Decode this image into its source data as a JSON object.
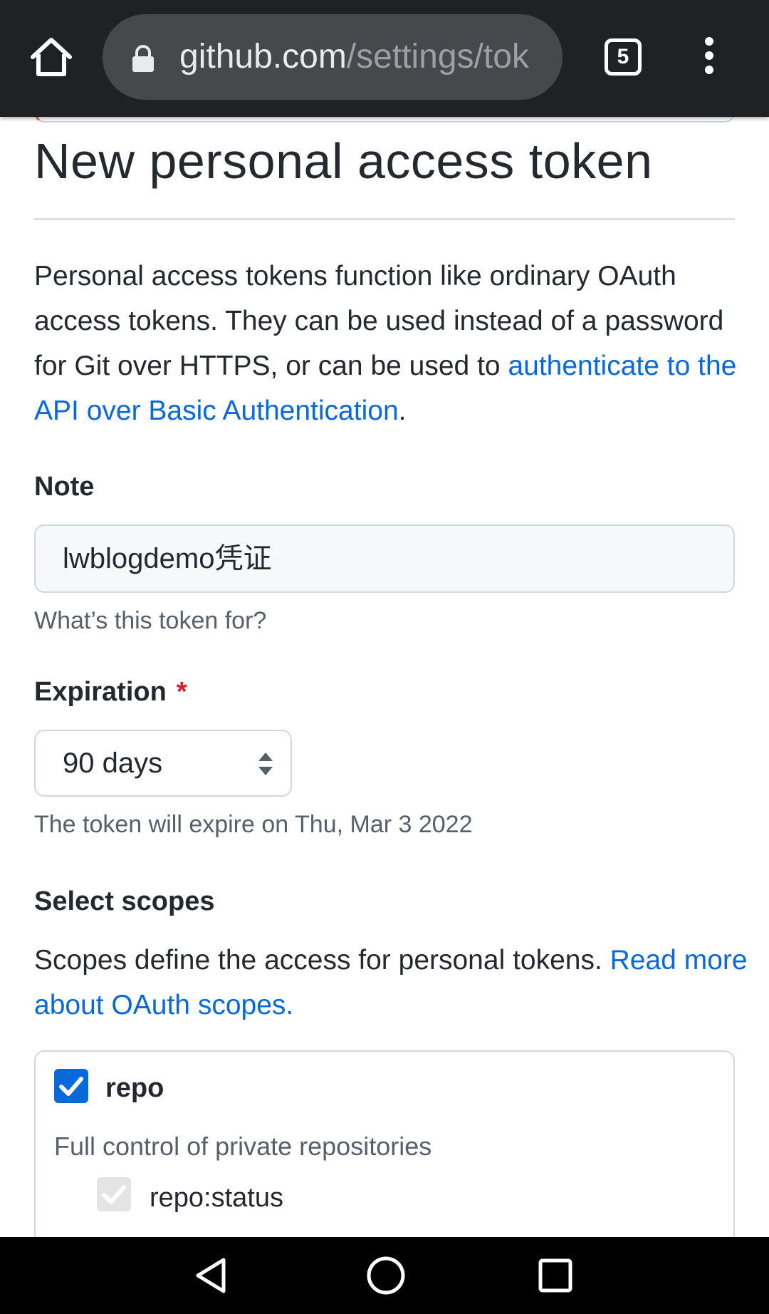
{
  "browser": {
    "url_domain": "github.com",
    "url_path": "/settings/tok",
    "tab_count": "5",
    "icons": [
      "home-icon",
      "lock-icon",
      "tabs-icon",
      "more-vert-icon"
    ]
  },
  "page": {
    "title": "New personal access token",
    "description_text": "Personal access tokens function like ordinary OAuth access tokens. They can be used instead of a password for Git over HTTPS, or can be used to ",
    "description_link": "authenticate to the API over Basic Authentication",
    "description_end": "."
  },
  "note": {
    "label": "Note",
    "value": "lwblogdemo凭证",
    "hint": "What’s this token for?"
  },
  "expiration": {
    "label": "Expiration",
    "required_mark": "*",
    "selected": "90 days",
    "hint": "The token will expire on Thu, Mar 3 2022"
  },
  "scopes": {
    "label": "Select scopes",
    "description": "Scopes define the access for personal tokens. ",
    "link": "Read more about OAuth scopes.",
    "items": [
      {
        "name": "repo",
        "checked": true,
        "description": "Full control of private repositories",
        "sub": [
          {
            "name": "repo:status",
            "checked": true,
            "disabled": true
          }
        ]
      }
    ]
  },
  "colors": {
    "link": "#0969da",
    "required": "#cf222e",
    "checkbox": "#0969da",
    "chrome_bg": "#202124"
  },
  "android_nav": [
    "back-icon",
    "home-circle-icon",
    "recents-icon"
  ]
}
